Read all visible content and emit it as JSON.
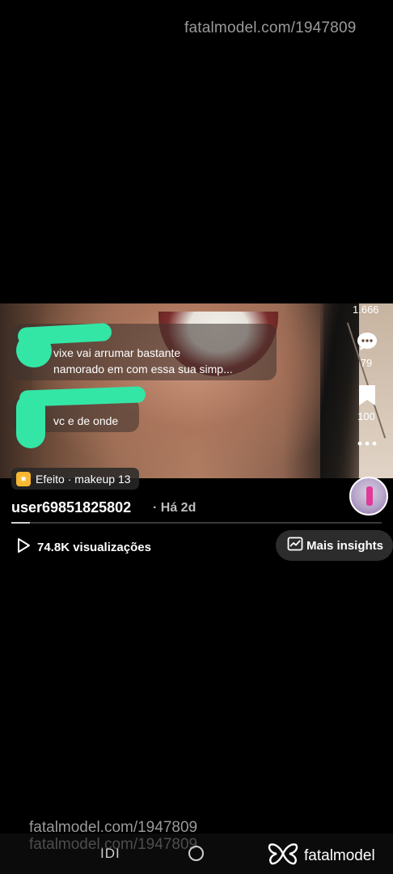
{
  "watermark": {
    "text": "fatalmodel.com/1947809"
  },
  "video": {
    "likes": "1.666",
    "comments_count": "79",
    "saves_count": "100",
    "comments": [
      {
        "line1": "vixe vai arrumar bastante",
        "line2": "namorado em com essa sua simp..."
      },
      {
        "line1": "vc e de onde"
      }
    ],
    "effect_label": "Efeito · makeup 13",
    "progress": 0.05
  },
  "post": {
    "username": "user69851825802",
    "time": "· Há 2d",
    "views": "74.8K visualizações",
    "insights_label": "Mais insights"
  },
  "navbar": {
    "recents_glyph": "IDI",
    "brand_name": "fatalmodel"
  }
}
